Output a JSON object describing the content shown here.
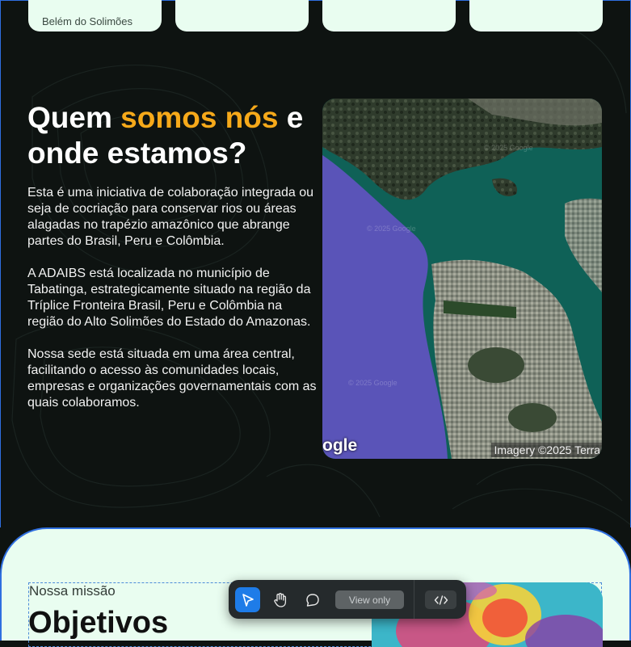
{
  "top_cards": {
    "first_caption": "Belém do Solimões"
  },
  "about": {
    "heading_part1": "Quem ",
    "heading_accent": "somos nós",
    "heading_part2": " e onde estamos?",
    "paragraphs": [
      "Esta é uma iniciativa de colaboração integrada ou seja de cocriação para conservar rios ou áreas alagadas no trapézio amazônico que abrange partes do Brasil, Peru e Colômbia.",
      "A ADAIBS está localizada no município de Tabatinga, estrategicamente situado na região da Tríplice Fronteira Brasil, Peru e Colômbia na região do Alto Solimões do Estado do Amazonas.",
      "Nossa sede está situada em uma área central, facilitando o acesso às comunidades locais, empresas e organizações governamentais com as quais colaboramos."
    ]
  },
  "map": {
    "logo_fragment": "ogle",
    "attribution": "Imagery ©2025 Terra",
    "watermark_1": "© 2025 Google",
    "watermark_2": "© 2025 Google",
    "watermark_3": "© 2025 Google"
  },
  "mission": {
    "label": "Nossa missão",
    "title": "Objetivos"
  },
  "toolbar": {
    "view_only_label": "View only",
    "tools": [
      "pointer-icon",
      "hand-icon",
      "comment-icon",
      "code-icon"
    ]
  },
  "colors": {
    "background": "#0e1311",
    "accent": "#f6a91a",
    "card": "#e9fdf0",
    "selection": "#2f6fe0",
    "toolbar_active": "#1e7ce8"
  }
}
